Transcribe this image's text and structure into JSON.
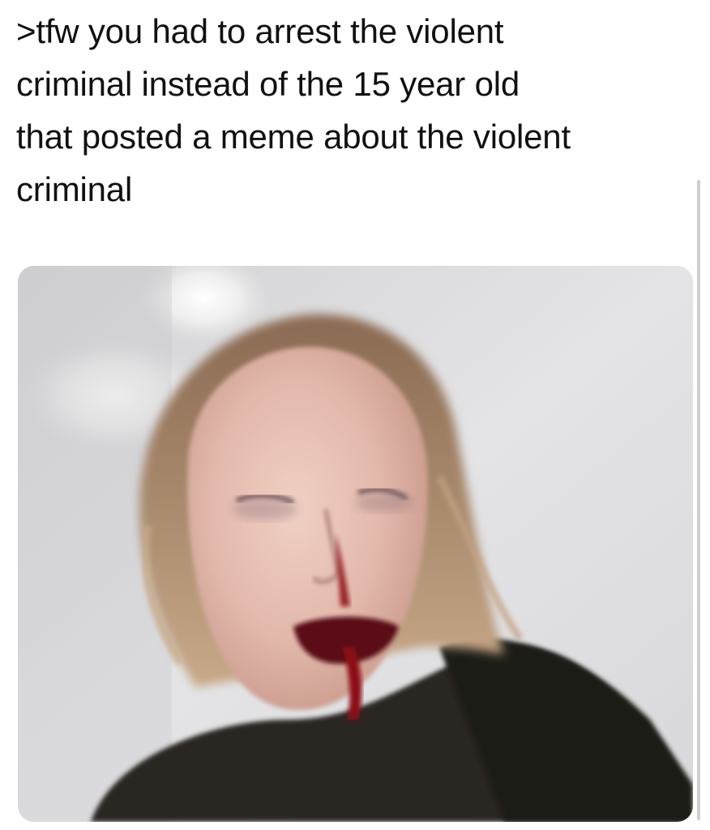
{
  "post": {
    "text": ">tfw you had to arrest the violent\ncriminal instead of the 15 year old\nthat posted a meme about the violent\ncriminal"
  },
  "media": {
    "kind": "photo",
    "icon": "photo-of-injured-woman-image"
  },
  "colors": {
    "background": "#ffffff",
    "text": "#111111",
    "scrollbar": "#cfcfcf",
    "wall": "#dcdcde",
    "blood": "#8c0f14"
  }
}
